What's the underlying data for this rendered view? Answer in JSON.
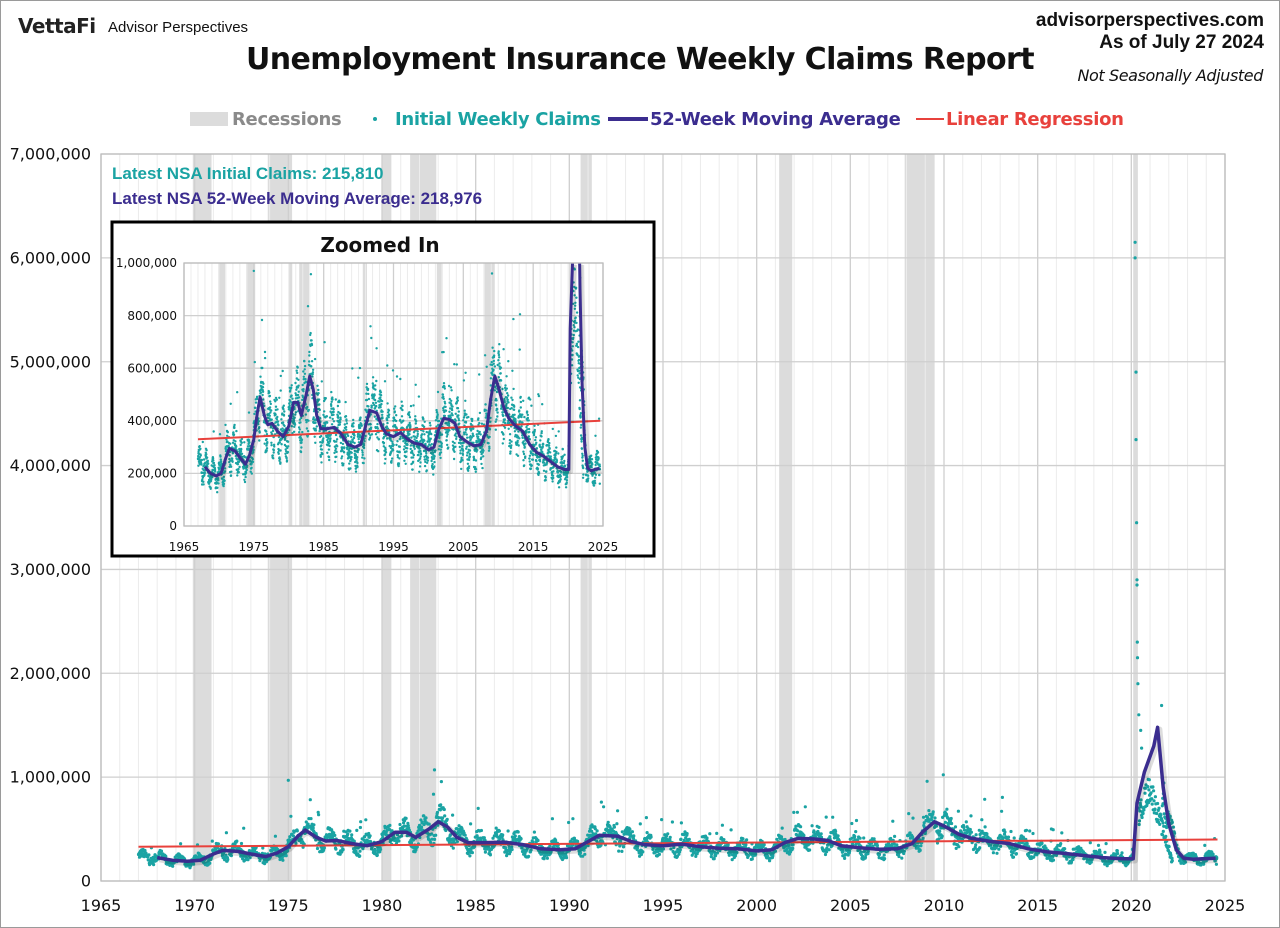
{
  "header": {
    "brand": "VettaFi",
    "brand_sub": "Advisor Perspectives",
    "title": "Unemployment Insurance Weekly Claims Report",
    "site": "advisorperspectives.com",
    "as_of": "As of July 27 2024",
    "adjustment": "Not Seasonally Adjusted"
  },
  "annotations": {
    "latest_claims": "Latest NSA Initial Claims: 215,810",
    "latest_ma": "Latest NSA 52-Week Moving Average: 218,976"
  },
  "colors": {
    "claims": "#1aa3a3",
    "moving_average": "#3b2d8f",
    "regression": "#e8413c",
    "recession": "#dcdcdc",
    "grid": "#d4d4d4"
  },
  "chart_data": [
    {
      "id": "main",
      "type": "scatter",
      "title": "Unemployment Insurance Weekly Claims Report",
      "xlabel": "",
      "ylabel": "",
      "xlim": [
        1965,
        2025
      ],
      "ylim": [
        0,
        7000000
      ],
      "x_ticks": [
        1965,
        1970,
        1975,
        1980,
        1985,
        1990,
        1995,
        2000,
        2005,
        2010,
        2015,
        2020,
        2025
      ],
      "x_tick_labels": [
        "1965",
        "1970",
        "1975",
        "1980",
        "1985",
        "1990",
        "1995",
        "2000",
        "2005",
        "2010",
        "2015",
        "2020",
        "2025"
      ],
      "y_ticks": [
        0,
        1000000,
        2000000,
        3000000,
        4000000,
        5000000,
        6000000,
        7000000
      ],
      "y_tick_labels": [
        "0",
        "1,000,000",
        "2,000,000",
        "3,000,000",
        "4,000,000",
        "5,000,000",
        "6,000,000",
        "7,000,000"
      ],
      "grid": true,
      "legend": {
        "position": "top",
        "entries": [
          {
            "label": "Recessions",
            "kind": "band"
          },
          {
            "label": "Initial Weekly Claims",
            "kind": "dot"
          },
          {
            "label": "52-Week Moving Average",
            "kind": "line"
          },
          {
            "label": "Linear Regression",
            "kind": "line"
          }
        ]
      },
      "recessions": [
        [
          1969.9,
          1970.9
        ],
        [
          1973.9,
          1975.2
        ],
        [
          1980.0,
          1980.5
        ],
        [
          1981.5,
          1982.9
        ],
        [
          1990.6,
          1991.2
        ],
        [
          2001.2,
          2001.9
        ],
        [
          2007.9,
          2009.5
        ],
        [
          2020.1,
          2020.35
        ]
      ],
      "series": [
        {
          "name": "52-Week Moving Average",
          "kind": "line",
          "points": [
            [
              1968.0,
              225000
            ],
            [
              1968.8,
              200000
            ],
            [
              1969.6,
              190000
            ],
            [
              1970.3,
              200000
            ],
            [
              1971.0,
              260000
            ],
            [
              1971.5,
              295000
            ],
            [
              1972.3,
              285000
            ],
            [
              1973.0,
              260000
            ],
            [
              1973.8,
              235000
            ],
            [
              1974.4,
              270000
            ],
            [
              1975.0,
              330000
            ],
            [
              1975.5,
              430000
            ],
            [
              1975.9,
              490000
            ],
            [
              1976.5,
              420000
            ],
            [
              1977.0,
              385000
            ],
            [
              1977.6,
              390000
            ],
            [
              1978.4,
              360000
            ],
            [
              1979.2,
              340000
            ],
            [
              1980.0,
              380000
            ],
            [
              1980.7,
              470000
            ],
            [
              1981.3,
              470000
            ],
            [
              1981.8,
              420000
            ],
            [
              1982.5,
              500000
            ],
            [
              1983.0,
              570000
            ],
            [
              1983.5,
              520000
            ],
            [
              1984.0,
              420000
            ],
            [
              1984.6,
              370000
            ],
            [
              1985.5,
              370000
            ],
            [
              1986.5,
              375000
            ],
            [
              1987.5,
              350000
            ],
            [
              1988.5,
              310000
            ],
            [
              1989.5,
              300000
            ],
            [
              1990.3,
              310000
            ],
            [
              1990.9,
              370000
            ],
            [
              1991.6,
              440000
            ],
            [
              1992.6,
              430000
            ],
            [
              1993.3,
              380000
            ],
            [
              1994.0,
              350000
            ],
            [
              1995.0,
              340000
            ],
            [
              1996.0,
              355000
            ],
            [
              1997.0,
              330000
            ],
            [
              1998.0,
              315000
            ],
            [
              1999.0,
              310000
            ],
            [
              2000.0,
              290000
            ],
            [
              2000.8,
              300000
            ],
            [
              2001.5,
              370000
            ],
            [
              2002.2,
              410000
            ],
            [
              2003.0,
              405000
            ],
            [
              2003.8,
              390000
            ],
            [
              2004.5,
              340000
            ],
            [
              2005.5,
              320000
            ],
            [
              2006.5,
              305000
            ],
            [
              2007.5,
              310000
            ],
            [
              2008.3,
              360000
            ],
            [
              2008.9,
              480000
            ],
            [
              2009.5,
              570000
            ],
            [
              2010.0,
              530000
            ],
            [
              2010.8,
              450000
            ],
            [
              2011.5,
              410000
            ],
            [
              2012.5,
              380000
            ],
            [
              2013.5,
              360000
            ],
            [
              2014.5,
              310000
            ],
            [
              2015.5,
              280000
            ],
            [
              2016.5,
              265000
            ],
            [
              2017.5,
              245000
            ],
            [
              2018.5,
              225000
            ],
            [
              2019.5,
              215000
            ],
            [
              2020.1,
              215000
            ],
            [
              2020.3,
              750000
            ],
            [
              2020.7,
              1050000
            ],
            [
              2021.2,
              1300000
            ],
            [
              2021.4,
              1480000
            ],
            [
              2021.7,
              900000
            ],
            [
              2022.0,
              550000
            ],
            [
              2022.4,
              300000
            ],
            [
              2022.8,
              220000
            ],
            [
              2023.3,
              210000
            ],
            [
              2023.8,
              215000
            ],
            [
              2024.5,
              218976
            ]
          ]
        },
        {
          "name": "Linear Regression",
          "kind": "line",
          "points": [
            [
              1967.0,
              330000
            ],
            [
              2024.6,
              400000
            ]
          ]
        },
        {
          "name": "Initial Weekly Claims",
          "kind": "scatter",
          "notable_points": [
            [
              1975.0,
              970000
            ],
            [
              1982.8,
              1070000
            ],
            [
              2009.1,
              960000
            ],
            [
              2020.2,
              6150000
            ],
            [
              2020.2,
              6000000
            ],
            [
              2020.25,
              4900000
            ],
            [
              2020.25,
              4250000
            ],
            [
              2020.28,
              3450000
            ],
            [
              2020.3,
              2900000
            ],
            [
              2020.3,
              2850000
            ],
            [
              2020.32,
              2300000
            ],
            [
              2020.33,
              2150000
            ],
            [
              2020.35,
              1900000
            ],
            [
              2020.4,
              1600000
            ],
            [
              2020.5,
              1450000
            ],
            [
              2020.55,
              1280000
            ],
            [
              2021.0,
              780000
            ],
            [
              2024.55,
              215810
            ]
          ],
          "note": "weekly NSA initial claims 1967–2024; dense cloud roughly ±100k around moving average with seasonal spikes"
        }
      ]
    },
    {
      "id": "inset",
      "type": "scatter",
      "title": "Zoomed In",
      "xlim": [
        1965,
        2025
      ],
      "ylim": [
        0,
        1000000
      ],
      "x_ticks": [
        1965,
        1975,
        1985,
        1995,
        2005,
        2015,
        2025
      ],
      "x_tick_labels": [
        "1965",
        "1975",
        "1985",
        "1995",
        "2005",
        "2015",
        "2025"
      ],
      "y_ticks": [
        0,
        200000,
        400000,
        600000,
        800000,
        1000000
      ],
      "y_tick_labels": [
        "0",
        "200,000",
        "400,000",
        "600,000",
        "800,000",
        "1,000,000"
      ],
      "grid": true
    }
  ]
}
